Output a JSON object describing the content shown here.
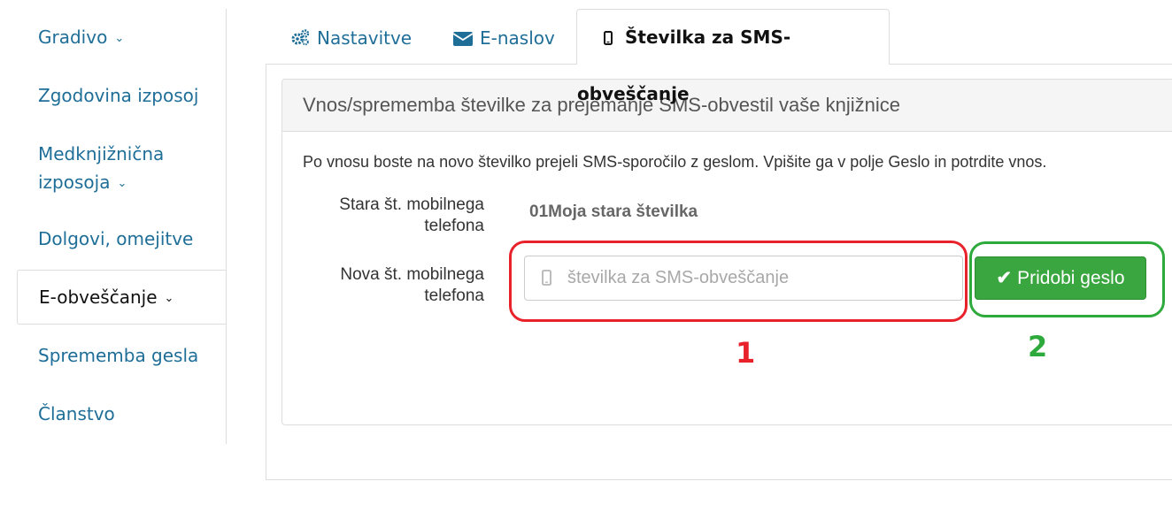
{
  "sidebar": {
    "items": [
      {
        "label": "Gradivo",
        "has_chevron": true
      },
      {
        "label": "Zgodovina izposoj"
      },
      {
        "label_line1": "Medknjižnična",
        "label_line2": "izposoja",
        "has_chevron": true
      },
      {
        "label": "Dolgovi, omejitve"
      },
      {
        "label": "E-obveščanje",
        "has_chevron": true,
        "active": true
      },
      {
        "label": "Sprememba gesla"
      },
      {
        "label": "Članstvo"
      }
    ],
    "chevron_icon": "chevron-down-icon"
  },
  "tabs": [
    {
      "label": "Nastavitve",
      "icon": "gears-icon"
    },
    {
      "label": "E-naslov",
      "icon": "envelope-icon"
    },
    {
      "label": "Številka za SMS-obveščanje",
      "icon": "mobile-phone-icon",
      "active": true
    }
  ],
  "panel": {
    "title": "Vnos/sprememba številke za prejemanje SMS-obvestil vaše knjižnice",
    "info": "Po vnosu boste na novo številko prejeli SMS-sporočilo z geslom. Vpišite ga v polje Geslo in potrdite vnos.",
    "old_label_line1": "Stara št. mobilnega",
    "old_label_line2": "telefona",
    "old_value": "01Moja stara številka",
    "new_label_line1": "Nova št. mobilnega",
    "new_label_line2": "telefona",
    "input_placeholder": "številka za SMS-obveščanje",
    "input_value": "",
    "button_label": "Pridobi geslo",
    "button_icon": "check-icon"
  },
  "annotations": {
    "marker_1": "1",
    "marker_2": "2"
  },
  "colors": {
    "link": "#1f6e98",
    "button": "#3aa63f",
    "highlight_red": "#e8222b",
    "highlight_green": "#2eaa3c"
  }
}
